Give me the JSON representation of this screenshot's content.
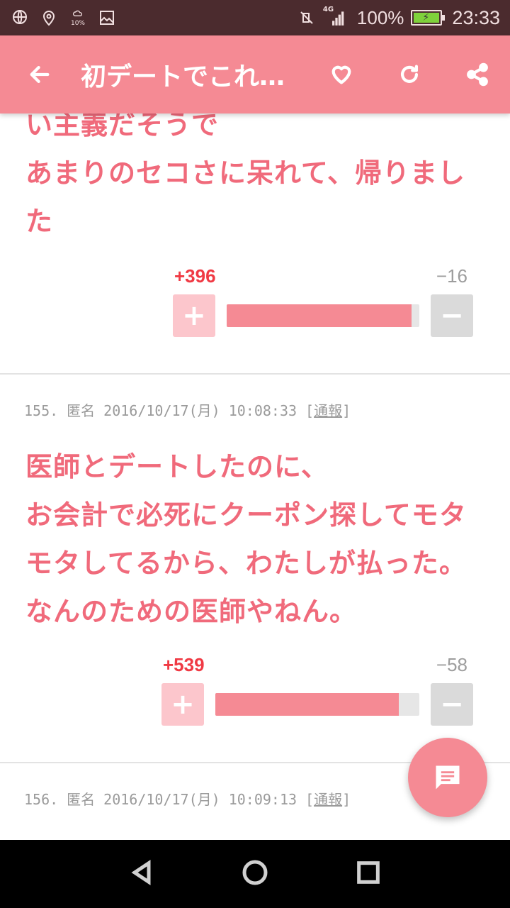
{
  "status_bar": {
    "battery_percent": "100%",
    "network": "4G",
    "weather_temp": "10%",
    "time": "23:33"
  },
  "app_bar": {
    "title": "初デートでこれ…"
  },
  "comments": [
    {
      "text_lines": [
        "い主義だそうで",
        "あまりのセコさに呆れて、帰りまし",
        "た"
      ],
      "plus": "+396",
      "minus": "−16",
      "plus_ratio": 0.96
    },
    {
      "number": "155.",
      "author": "匿名",
      "datetime": "2016/10/17(月) 10:08:33",
      "report_open": "[",
      "report": "通報",
      "report_close": "]",
      "text_lines": [
        "医師とデートしたのに、",
        "お会計で必死にクーポン探してモタ",
        "モタしてるから、わたしが払った。",
        "なんのための医師やねん。"
      ],
      "plus": "+539",
      "minus": "−58",
      "plus_ratio": 0.9
    },
    {
      "number": "156.",
      "author": "匿名",
      "datetime": "2016/10/17(月) 10:09:13",
      "report_open": "[",
      "report": "通報",
      "report_close": "]"
    }
  ],
  "colors": {
    "accent": "#f58a94",
    "comment_text": "#f06a7b",
    "plus_count": "#f03a44"
  }
}
